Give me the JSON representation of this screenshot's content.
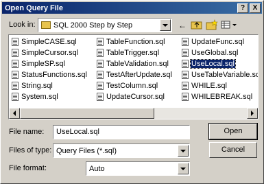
{
  "window": {
    "title": "Open Query File",
    "help_label": "?",
    "close_label": "X"
  },
  "look_in": {
    "label": "Look in:",
    "value": "SQL 2000 Step by Step"
  },
  "toolbar": {
    "back_icon": "back-arrow-icon",
    "up_folder_icon": "up-folder-icon",
    "new_folder_icon": "new-folder-icon",
    "views_icon": "views-menu-icon"
  },
  "files": {
    "columns": [
      [
        "SimpleCASE.sql",
        "SimpleCursor.sql",
        "SimpleSP.sql",
        "StatusFunctions.sql",
        "String.sql",
        "System.sql"
      ],
      [
        "TableFunction.sql",
        "TableTrigger.sql",
        "TableValidation.sql",
        "TestAfterUpdate.sql",
        "TestColumn.sql",
        "UpdateCursor.sql"
      ],
      [
        "UpdateFunc.sql",
        "UseGlobal.sql",
        "UseLocal.sql",
        "UseTableVariable.sql",
        "WHILE.sql",
        "WHILEBREAK.sql"
      ]
    ],
    "selected": "UseLocal.sql"
  },
  "file_name": {
    "label": "File name:",
    "value": "UseLocal.sql"
  },
  "files_of_type": {
    "label": "Files of type:",
    "value": "Query Files (*.sql)"
  },
  "file_format": {
    "label": "File format:",
    "value": "Auto"
  },
  "buttons": {
    "open": "Open",
    "cancel": "Cancel"
  },
  "colors": {
    "title_bar": "#0a246a",
    "selection": "#0a246a",
    "face": "#d4d0c8"
  }
}
